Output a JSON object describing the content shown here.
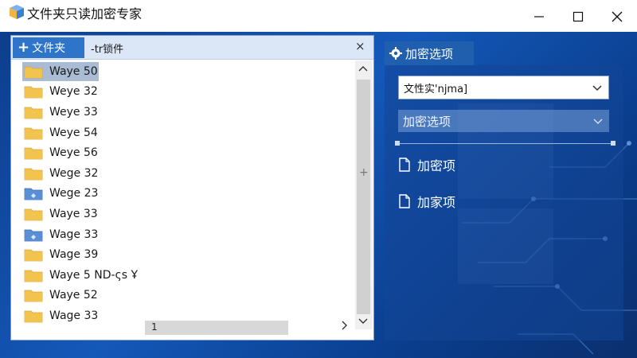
{
  "window": {
    "title": "文件夹只读加密专家"
  },
  "left_panel": {
    "new_folder_label": "文件夹",
    "header_path": "-tr锁件",
    "close_symbol": "×",
    "folders": [
      {
        "name": "Waye 50",
        "type": "yellow",
        "selected": true
      },
      {
        "name": "Weye 32",
        "type": "yellow"
      },
      {
        "name": "Weye 33",
        "type": "yellow"
      },
      {
        "name": "Weye 54",
        "type": "yellow"
      },
      {
        "name": "Weye 56",
        "type": "yellow"
      },
      {
        "name": "Wege 32",
        "type": "yellow"
      },
      {
        "name": "Wege 23",
        "type": "blue"
      },
      {
        "name": "Waye 33",
        "type": "yellow"
      },
      {
        "name": "Wage 33",
        "type": "blue"
      },
      {
        "name": "Wage 39",
        "type": "yellow"
      },
      {
        "name": "Waye 5 ND-ςs Ұ",
        "type": "yellow"
      },
      {
        "name": "Waye 52",
        "type": "yellow"
      },
      {
        "name": "Wage 33",
        "type": "yellow"
      }
    ],
    "hscroll_value": "1",
    "side_symbol": "+"
  },
  "right_panel": {
    "tab_label": "加密选项",
    "dropdown_value": "文性实'njma]",
    "mode_select_label": "加密选项",
    "options": [
      {
        "label": "加密项"
      },
      {
        "label": "加家项"
      }
    ]
  },
  "colors": {
    "accent": "#2e74c9",
    "selected_row": "#a9bcd3",
    "folder_yellow": "#f2c44f",
    "folder_blue": "#5b8fd6"
  }
}
